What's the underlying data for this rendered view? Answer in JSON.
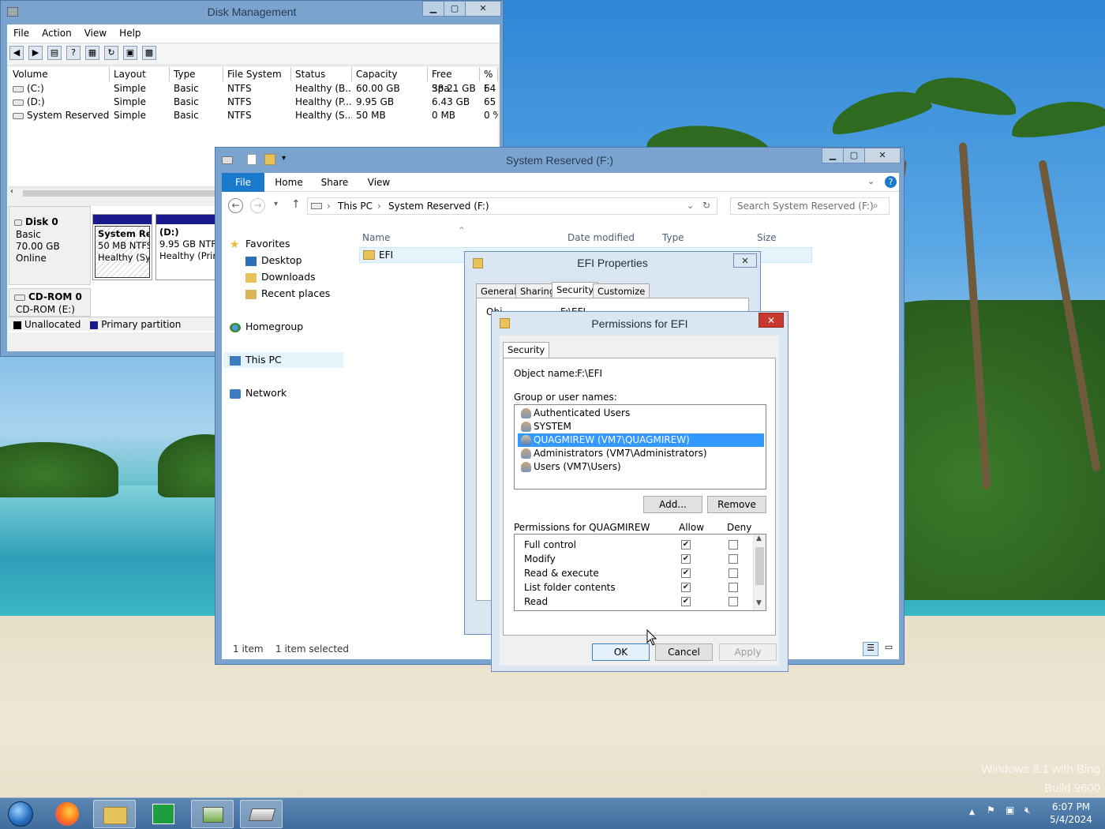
{
  "desktop": {
    "watermark_line1": "Windows 8.1 with Bing",
    "watermark_line2": "Build 9600"
  },
  "disk_mgmt": {
    "title": "Disk Management",
    "menu": [
      "File",
      "Action",
      "View",
      "Help"
    ],
    "columns": [
      "Volume",
      "Layout",
      "Type",
      "File System",
      "Status",
      "Capacity",
      "Free Spa...",
      "% F"
    ],
    "rows": [
      [
        "(C:)",
        "Simple",
        "Basic",
        "NTFS",
        "Healthy (B...",
        "60.00 GB",
        "38.21 GB",
        "64"
      ],
      [
        "(D:)",
        "Simple",
        "Basic",
        "NTFS",
        "Healthy (P...",
        "9.95 GB",
        "6.43 GB",
        "65"
      ],
      [
        "System Reserved (...",
        "Simple",
        "Basic",
        "NTFS",
        "Healthy (S...",
        "50 MB",
        "0 MB",
        "0 %"
      ]
    ],
    "disk0": {
      "name": "Disk 0",
      "type": "Basic",
      "size": "70.00 GB",
      "state": "Online"
    },
    "part1": {
      "name": "System Res",
      "size": "50 MB NTFS",
      "status": "Healthy (Sys"
    },
    "part2": {
      "name": "(D:)",
      "size": "9.95 GB NTFS",
      "status": "Healthy (Prim"
    },
    "cdrom": {
      "name": "CD-ROM 0",
      "label": "CD-ROM (E:)"
    },
    "legend": [
      "Unallocated",
      "Primary partition"
    ],
    "colors": {
      "partition_header": "#1a1a8c",
      "unallocated": "#000000"
    }
  },
  "explorer": {
    "title": "System Reserved (F:)",
    "tabs": [
      "File",
      "Home",
      "Share",
      "View"
    ],
    "address": [
      "This PC",
      "System Reserved (F:)"
    ],
    "search_placeholder": "Search System Reserved (F:)",
    "columns": [
      "Name",
      "Date modified",
      "Type",
      "Size"
    ],
    "files": [
      {
        "name": "EFI"
      }
    ],
    "nav": {
      "favorites": "Favorites",
      "desktop": "Desktop",
      "downloads": "Downloads",
      "recent": "Recent places",
      "homegroup": "Homegroup",
      "thispc": "This PC",
      "network": "Network"
    },
    "status_items": "1 item",
    "status_selected": "1 item selected",
    "colors": {
      "file_tab": "#1979ca"
    }
  },
  "efi_props": {
    "title": "EFI Properties",
    "tabs": [
      "General",
      "Sharing",
      "Security",
      "Customize"
    ],
    "object_label_partial": "Obj",
    "object_value_partial": "F:\\EFI"
  },
  "permissions": {
    "title": "Permissions for EFI",
    "tab": "Security",
    "object_label": "Object name:",
    "object_value": "F:\\EFI",
    "group_label": "Group or user names:",
    "users": [
      "Authenticated Users",
      "SYSTEM",
      "QUAGMIREW (VM7\\QUAGMIREW)",
      "Administrators (VM7\\Administrators)",
      "Users (VM7\\Users)"
    ],
    "selected_user_index": 2,
    "add_label": "Add...",
    "remove_label": "Remove",
    "perm_header": "Permissions for QUAGMIREW",
    "allow_label": "Allow",
    "deny_label": "Deny",
    "perms": [
      {
        "name": "Full control",
        "allow": true,
        "deny": false
      },
      {
        "name": "Modify",
        "allow": true,
        "deny": false
      },
      {
        "name": "Read & execute",
        "allow": true,
        "deny": false
      },
      {
        "name": "List folder contents",
        "allow": true,
        "deny": false
      },
      {
        "name": "Read",
        "allow": true,
        "deny": false
      }
    ],
    "ok_label": "OK",
    "cancel_label": "Cancel",
    "apply_label": "Apply",
    "colors": {
      "selection": "#3399ff",
      "close": "#c7392f"
    }
  },
  "taskbar": {
    "time": "6:07 PM",
    "date": "5/4/2024"
  }
}
